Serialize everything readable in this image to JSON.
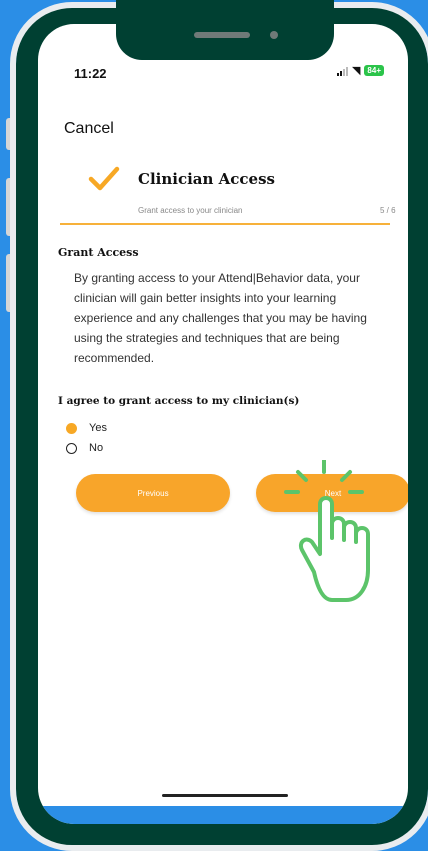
{
  "status_bar": {
    "time": "11:22",
    "battery_label": "84+"
  },
  "header": {
    "cancel_label": "Cancel"
  },
  "step": {
    "title": "Clinician Access",
    "subtitle": "Grant access to your clinician",
    "count": "5 / 6",
    "progress_fraction": 0.833
  },
  "content": {
    "section_title": "Grant Access",
    "paragraph": "By granting access to your Attend|Behavior data, your clinician will gain better insights into your learning experience and any challenges that you may be having using the strategies and techniques that are being recommended.",
    "question": "I agree to grant access to my clinician(s)",
    "options": [
      {
        "label": "Yes",
        "selected": true
      },
      {
        "label": "No",
        "selected": false
      }
    ]
  },
  "buttons": {
    "previous_label": "Previous",
    "next_label": "Next"
  },
  "colors": {
    "accent": "#f8a52a",
    "phone_frame": "#004032",
    "background": "#2b8ee6",
    "hand_outline": "#5cc46a"
  }
}
